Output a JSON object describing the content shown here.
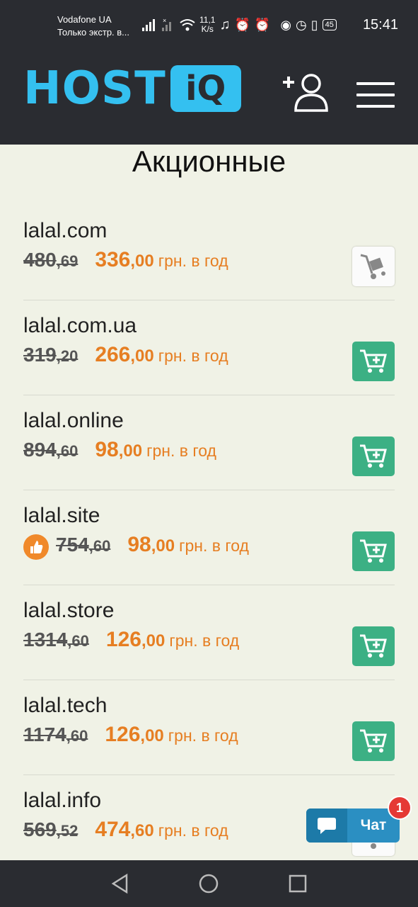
{
  "status_bar": {
    "carrier": "Vodafone UA",
    "carrier_sub": "Только экстр. в...",
    "speed_value": "11,1",
    "speed_unit": "K/s",
    "battery": "45",
    "time": "15:41"
  },
  "header": {
    "logo_host": "HOST",
    "logo_iq": "iQ"
  },
  "page": {
    "title": "Акционные"
  },
  "domains": [
    {
      "name": "lalal.com",
      "old_int": "480",
      "old_dec": ",69",
      "new_int": "336",
      "new_dec": ",00",
      "unit": "грн. в год",
      "cart_enabled": false,
      "hot": false
    },
    {
      "name": "lalal.com.ua",
      "old_int": "319",
      "old_dec": ",20",
      "new_int": "266",
      "new_dec": ",00",
      "unit": "грн. в год",
      "cart_enabled": true,
      "hot": false
    },
    {
      "name": "lalal.online",
      "old_int": "894",
      "old_dec": ",60",
      "new_int": "98",
      "new_dec": ",00",
      "unit": "грн. в год",
      "cart_enabled": true,
      "hot": false
    },
    {
      "name": "lalal.site",
      "old_int": "754",
      "old_dec": ",60",
      "new_int": "98",
      "new_dec": ",00",
      "unit": "грн. в год",
      "cart_enabled": true,
      "hot": true
    },
    {
      "name": "lalal.store",
      "old_int": "1314",
      "old_dec": ",60",
      "new_int": "126",
      "new_dec": ",00",
      "unit": "грн. в год",
      "cart_enabled": true,
      "hot": false
    },
    {
      "name": "lalal.tech",
      "old_int": "1174",
      "old_dec": ",60",
      "new_int": "126",
      "new_dec": ",00",
      "unit": "грн. в год",
      "cart_enabled": true,
      "hot": false
    },
    {
      "name": "lalal.info",
      "old_int": "569",
      "old_dec": ",52",
      "new_int": "474",
      "new_dec": ",60",
      "unit": "грн. в год",
      "cart_enabled": false,
      "hot": false
    }
  ],
  "chat": {
    "label": "Чат",
    "badge": "1"
  },
  "colors": {
    "header_bg": "#2a2c31",
    "brand": "#34c0f0",
    "price_accent": "#e67e22",
    "cart_green": "#3cb084",
    "chat_blue": "#2b8fc2"
  }
}
